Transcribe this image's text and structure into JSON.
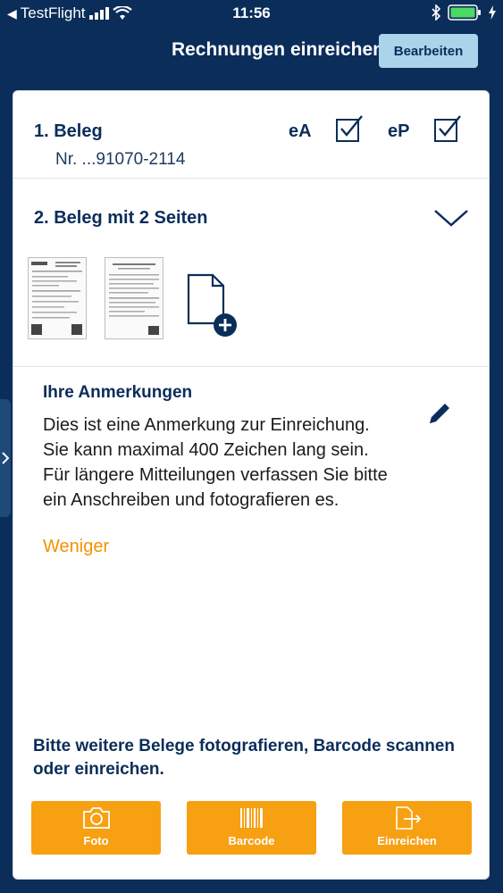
{
  "status_bar": {
    "carrier": "TestFlight",
    "time": "11:56"
  },
  "nav": {
    "title": "Rechnungen einreichen",
    "edit_label": "Bearbeiten"
  },
  "beleg1": {
    "title": "1. Beleg",
    "number": "Nr. ...91070-2114",
    "ea_label": "eA",
    "ep_label": "eP",
    "ea_checked": true,
    "ep_checked": true
  },
  "beleg2": {
    "title": "2. Beleg mit 2 Seiten"
  },
  "notes": {
    "title": "Ihre Anmerkungen",
    "text": "Dies ist eine Anmerkung zur Einreichung. Sie kann maximal 400 Zeichen lang sein. Für längere Mitteilungen verfassen Sie bitte ein Anschreiben und fotografieren es.",
    "less_label": "Weniger"
  },
  "hint": "Bitte weitere Belege fotografieren, Barcode scannen oder einreichen.",
  "actions": {
    "foto": "Foto",
    "barcode": "Barcode",
    "einreichen": "Einreichen"
  },
  "colors": {
    "navy": "#0b2d5a",
    "accent_orange": "#f7a012",
    "link_orange": "#f39200",
    "edit_button_bg": "#a9d4ea"
  },
  "icons": [
    "wifi-icon",
    "signal-icon",
    "bluetooth-icon",
    "battery-icon",
    "checkbox-icon",
    "chevron-down-icon",
    "add-page-icon",
    "pencil-icon",
    "camera-icon",
    "barcode-icon",
    "submit-icon",
    "chevron-right-icon"
  ]
}
